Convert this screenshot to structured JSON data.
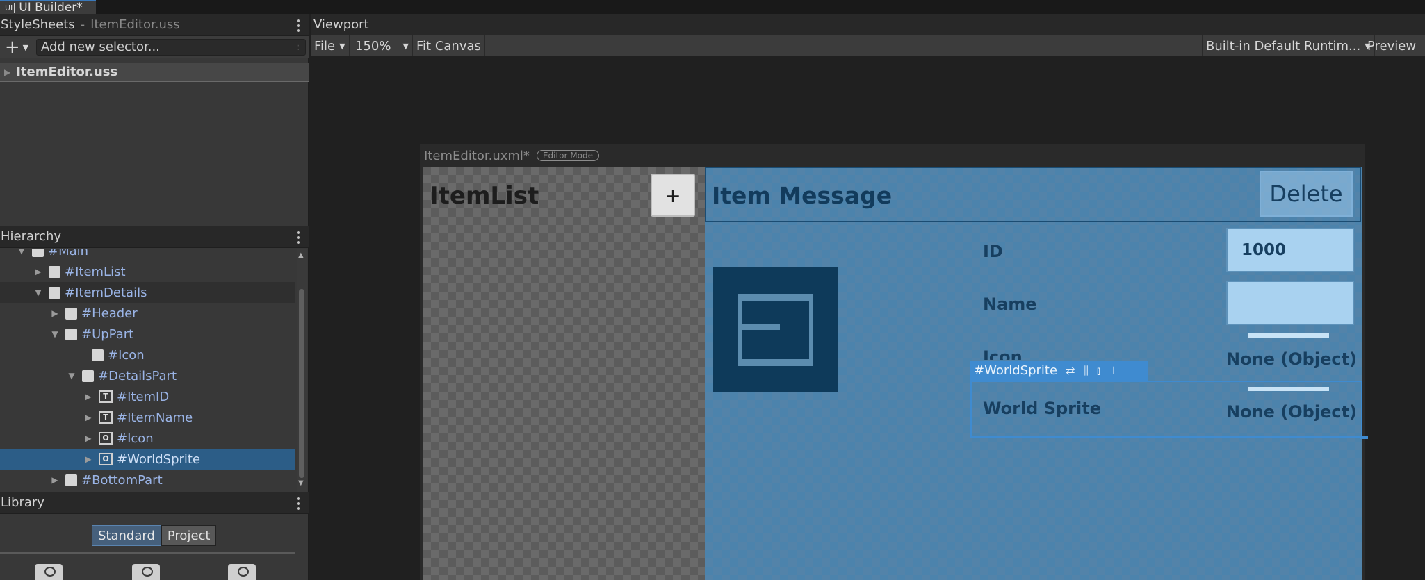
{
  "window": {
    "tab_title": "UI Builder*",
    "logo": "UI"
  },
  "stylesheets": {
    "title": "StyleSheets",
    "separator": "-",
    "file_name": "ItemEditor.uss",
    "add_label": "+",
    "selector_placeholder": "Add new selector...",
    "selector_hint": ":",
    "file_row": "ItemEditor.uss"
  },
  "hierarchy": {
    "title": "Hierarchy",
    "items": [
      {
        "label": "#Main"
      },
      {
        "label": "#ItemList"
      },
      {
        "label": "#ItemDetails"
      },
      {
        "label": "#Header"
      },
      {
        "label": "#UpPart"
      },
      {
        "label": "#Icon"
      },
      {
        "label": "#DetailsPart"
      },
      {
        "label": "#ItemID",
        "control": "T"
      },
      {
        "label": "#ItemName",
        "control": "T"
      },
      {
        "label": "#Icon",
        "control": "O"
      },
      {
        "label": "#WorldSprite",
        "control": "O"
      },
      {
        "label": "#BottomPart"
      }
    ]
  },
  "library": {
    "title": "Library",
    "tabs": [
      "Standard",
      "Project"
    ]
  },
  "viewport": {
    "title": "Viewport",
    "toolbar": {
      "file": "File",
      "zoom": "150%",
      "fit": "Fit Canvas",
      "theme": "Built-in Default Runtim...",
      "preview": "Preview"
    }
  },
  "canvas": {
    "doc_title": "ItemEditor.uxml*",
    "mode": "Editor Mode",
    "item_list": "ItemList",
    "plus": "+",
    "item_message": "Item Message",
    "delete": "Delete",
    "fields": {
      "id_label": "ID",
      "id_value": "1000",
      "name_label": "Name",
      "icon_label": "Icon",
      "icon_value": "None (Object)",
      "world_sprite_label": "World Sprite",
      "world_sprite_value": "None (Object)"
    },
    "selection_tag": "#WorldSprite"
  },
  "colors": {
    "accent": "#3f8bd0",
    "selection": "#2c5d87",
    "details_bg": "#4a7ea3"
  }
}
